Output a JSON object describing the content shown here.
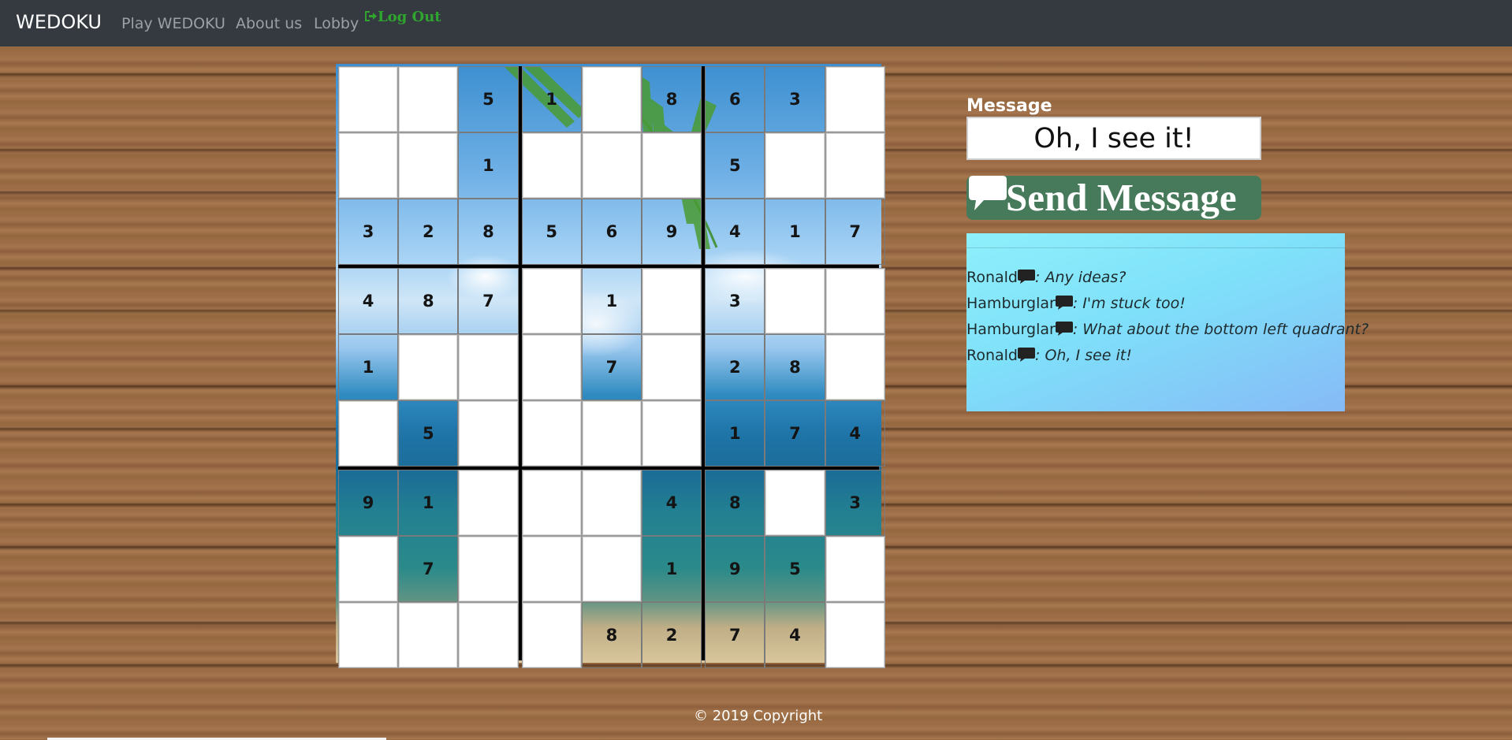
{
  "nav": {
    "brand": "WEDOKU",
    "links": [
      "Play WEDOKU",
      "About us",
      "Lobby"
    ],
    "logout": "Log Out"
  },
  "colors": {
    "navbar": "#343a40",
    "send_button": "#47795b",
    "logout": "#2fa52f"
  },
  "board": {
    "rows": [
      [
        "",
        "",
        "5",
        "1",
        "",
        "8",
        "6",
        "3",
        ""
      ],
      [
        "",
        "",
        "1",
        "",
        "",
        "",
        "5",
        "",
        ""
      ],
      [
        "3",
        "2",
        "8",
        "5",
        "6",
        "9",
        "4",
        "1",
        "7"
      ],
      [
        "4",
        "8",
        "7",
        "",
        "1",
        "",
        "3",
        "",
        ""
      ],
      [
        "1",
        "",
        "",
        "",
        "7",
        "",
        "2",
        "8",
        ""
      ],
      [
        "",
        "5",
        "",
        "",
        "",
        "",
        "1",
        "7",
        "4"
      ],
      [
        "9",
        "1",
        "",
        "",
        "",
        "4",
        "8",
        "",
        "3"
      ],
      [
        "",
        "7",
        "",
        "",
        "",
        "1",
        "9",
        "5",
        ""
      ],
      [
        "",
        "",
        "",
        "",
        "8",
        "2",
        "7",
        "4",
        ""
      ]
    ]
  },
  "message": {
    "label": "Message",
    "value": "Oh, I see it!",
    "send_label": "Send Message"
  },
  "chat": [
    {
      "user": "Ronald",
      "text": ": Any ideas?"
    },
    {
      "user": "Hamburglar",
      "text": ": I'm stuck too!"
    },
    {
      "user": "Hamburglar",
      "text": ": What about the bottom left quadrant?"
    },
    {
      "user": "Ronald",
      "text": ": Oh, I see it!"
    }
  ],
  "footer": "© 2019 Copyright"
}
